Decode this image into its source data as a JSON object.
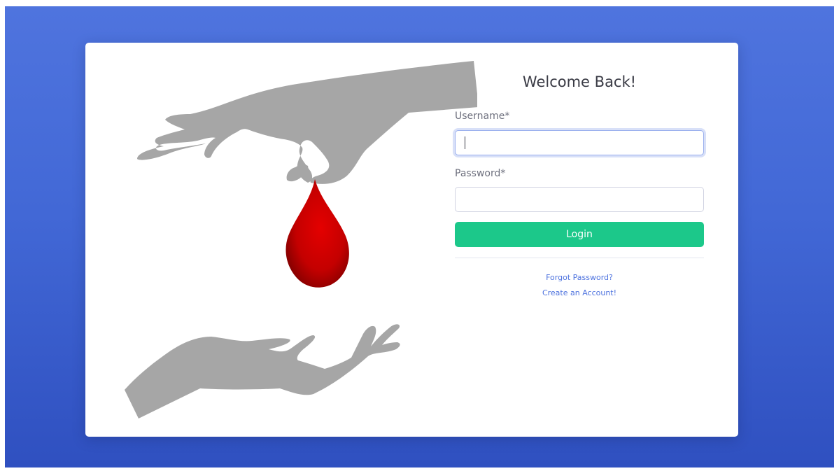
{
  "login": {
    "title": "Welcome Back!",
    "username_label": "Username*",
    "username_value": "",
    "password_label": "Password*",
    "password_value": "",
    "login_button": "Login",
    "forgot_password_link": "Forgot Password?",
    "create_account_link": "Create an Account!"
  },
  "illustration": {
    "icons": [
      "giving-hand-icon",
      "blood-drop-icon",
      "receiving-hand-icon"
    ]
  },
  "colors": {
    "background_gradient_top": "#4f74de",
    "background_gradient_bottom": "#2f50c0",
    "card": "#ffffff",
    "hand": "#a6a6a6",
    "blood_drop": "#c40000",
    "login_button": "#1cc88a",
    "link": "#4e73df",
    "label": "#6e707e",
    "title": "#3a3b45"
  }
}
